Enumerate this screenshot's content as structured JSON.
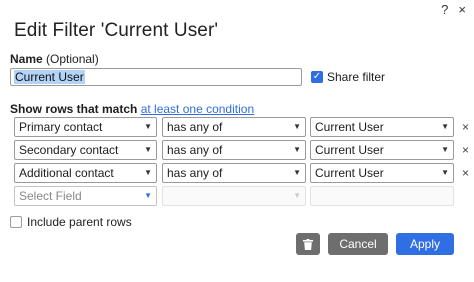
{
  "header": {
    "help_icon": "?",
    "close_icon": "×"
  },
  "dialog": {
    "title": "Edit Filter 'Current User'"
  },
  "name_field": {
    "label_bold": "Name",
    "label_rest": " (Optional)",
    "value": "Current User"
  },
  "share": {
    "label": "Share filter",
    "checked": true
  },
  "match": {
    "prefix": "Show rows that match",
    "link": "at least one condition"
  },
  "conditions": [
    {
      "field": "Primary contact",
      "operator": "has any of",
      "value": "Current User"
    },
    {
      "field": "Secondary contact",
      "operator": "has any of",
      "value": "Current User"
    },
    {
      "field": "Additional contact",
      "operator": "has any of",
      "value": "Current User"
    }
  ],
  "new_condition": {
    "field_placeholder": "Select Field"
  },
  "remove_icon": "×",
  "parent_rows": {
    "label": "Include parent rows",
    "checked": false
  },
  "buttons": {
    "cancel": "Cancel",
    "apply": "Apply",
    "delete_icon": "trash-icon"
  },
  "colors": {
    "accent": "#2f6fe3",
    "secondary_button": "#6e6e6e",
    "selection": "#b3d3f7"
  }
}
